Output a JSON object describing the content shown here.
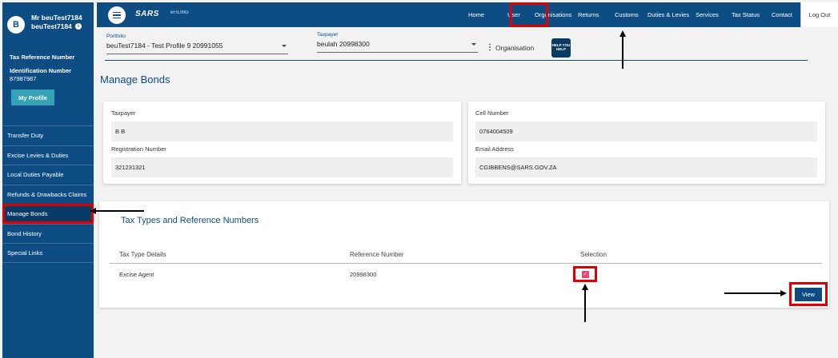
{
  "user": {
    "avatar_initial": "B",
    "name_line1": "Mr beuTest7184",
    "name_line2": "beuTest7184"
  },
  "profile": {
    "tax_ref_label": "Tax Reference Number",
    "id_label": "Identification Number",
    "id_value": "87987987",
    "my_profile_button": "My Profile"
  },
  "sidebar": {
    "items": [
      {
        "label": "Transfer Duty"
      },
      {
        "label": "Excise Levies & Duties"
      },
      {
        "label": "Local Duties Payable"
      },
      {
        "label": "Refunds & Drawbacks Claims"
      },
      {
        "label": "Manage Bonds"
      },
      {
        "label": "Bond History"
      },
      {
        "label": "Special Links"
      }
    ]
  },
  "topbar": {
    "logo": "SARS",
    "efiling": "eFILING",
    "nav": [
      {
        "label": "Home"
      },
      {
        "label": "User"
      },
      {
        "label": "Organisations"
      },
      {
        "label": "Returns"
      },
      {
        "label": "Customs"
      },
      {
        "label": "Duties & Levies"
      },
      {
        "label": "Services"
      },
      {
        "label": "Tax Status"
      },
      {
        "label": "Contact"
      }
    ],
    "logout": "Log Out"
  },
  "selectors": {
    "portfolio_label": "Portfolio",
    "portfolio_value": "beuTest7184 - Test Profile 9 20991055",
    "taxpayer_label": "Taxpayer",
    "taxpayer_value": "beulah 20998300",
    "organisation_label": "Organisation",
    "org_logo_text": "HELP YOU HELP"
  },
  "page": {
    "title": "Manage Bonds"
  },
  "details": {
    "taxpayer_label": "Taxpayer",
    "taxpayer_value": "B B",
    "registration_label": "Registration Number",
    "registration_value": "321231321",
    "cell_label": "Cell Number",
    "cell_value": "0764004509",
    "email_label": "Email Address",
    "email_value": "CGIBBENS@SARS.GOV.ZA"
  },
  "tax_types": {
    "title": "Tax Types and Reference Numbers",
    "columns": [
      "Tax Type Details",
      "Reference Number",
      "Selection"
    ],
    "rows": [
      {
        "type": "Excise Agent",
        "reference": "20998300",
        "selected": true
      }
    ],
    "view_button": "View"
  },
  "colors": {
    "brand_blue": "#0d4d84",
    "highlight_red": "#e00000",
    "profile_teal": "#36a2b5",
    "checkbox_pink": "#e8457a"
  }
}
